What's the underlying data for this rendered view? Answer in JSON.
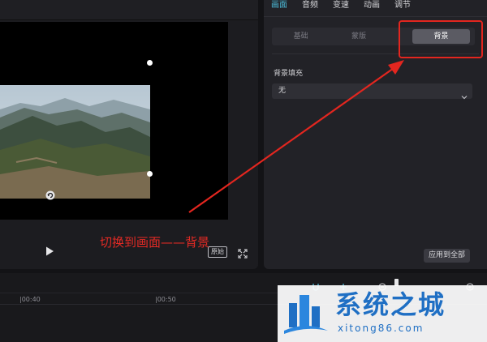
{
  "properties_panel": {
    "tabs": [
      {
        "label": "画面",
        "active": true
      },
      {
        "label": "音频",
        "active": false
      },
      {
        "label": "变速",
        "active": false
      },
      {
        "label": "动画",
        "active": false
      },
      {
        "label": "调节",
        "active": false
      }
    ],
    "subtabs": [
      {
        "label": "基础",
        "active": false
      },
      {
        "label": "蒙版",
        "active": false
      },
      {
        "label": "背景",
        "active": true
      }
    ],
    "background_fill": {
      "label": "背景填充",
      "selected": "无"
    },
    "apply_all_label": "应用到全部"
  },
  "player": {
    "ratio_label": "原始"
  },
  "annotation": {
    "text": "切换到画面——背景",
    "color": "#e32a24"
  },
  "timeline": {
    "ticks": [
      {
        "label": "|00:40"
      },
      {
        "label": "|00:50"
      }
    ]
  },
  "watermark": {
    "name": "系统之城",
    "url": "xitong86.com"
  },
  "colors": {
    "accent": "#4bb9d6",
    "highlight": "#e3261f",
    "watermark": "#1f6fc4"
  }
}
